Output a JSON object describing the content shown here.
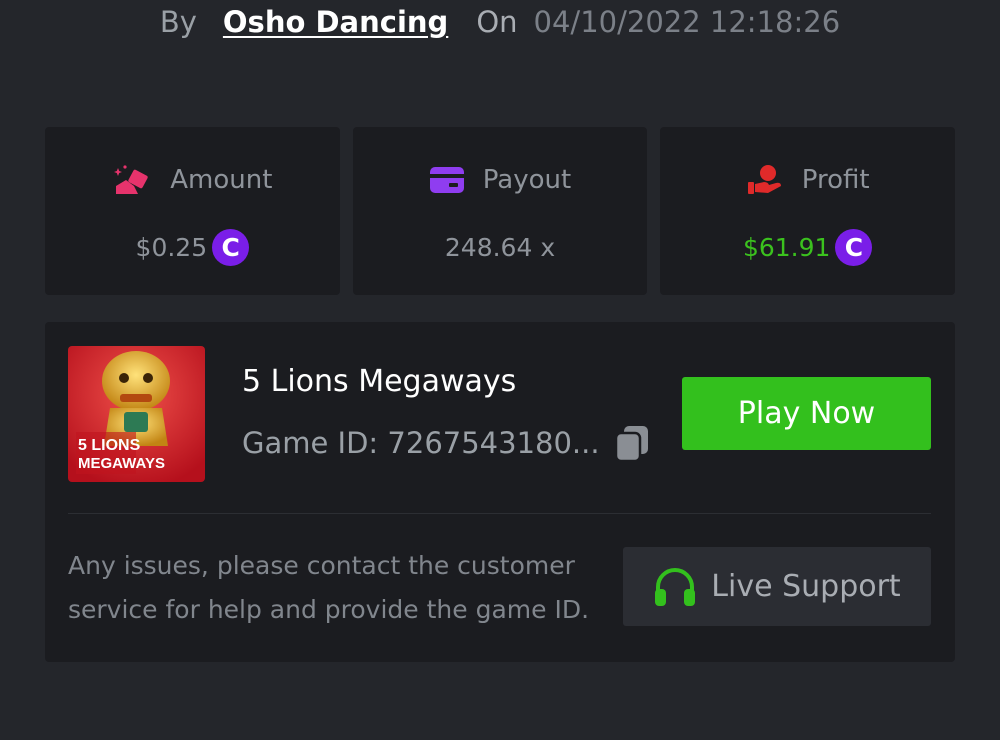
{
  "byline": {
    "by_label": "By",
    "author": "Osho Dancing",
    "on_label": "On",
    "date": "04/10/2022 12:18:26"
  },
  "stats": {
    "amount": {
      "label": "Amount",
      "value": "$0.25",
      "icon": "bet-amount-icon",
      "coin_symbol": "C"
    },
    "payout": {
      "label": "Payout",
      "value": "248.64 x",
      "icon": "credit-card-icon"
    },
    "profit": {
      "label": "Profit",
      "value": "$61.91",
      "icon": "hand-profit-icon",
      "coin_symbol": "C"
    }
  },
  "game": {
    "title": "5 Lions Megaways",
    "id_label": "Game ID: 7267543180...",
    "thumbnail_text_line1": "5 LIONS",
    "thumbnail_text_line2": "MEGAWAYS",
    "play_label": "Play Now"
  },
  "support": {
    "notice": "Any issues, please contact the customer service for help and provide the game ID.",
    "button_label": "Live Support"
  },
  "colors": {
    "background": "#24262b",
    "card": "#1b1c20",
    "accent_green": "#33c01d",
    "profit_green": "#3bc11e",
    "coin_purple": "#7a1ee8",
    "amount_icon": "#e6336c",
    "payout_icon": "#8f3df0",
    "profit_icon": "#e02a2a"
  }
}
